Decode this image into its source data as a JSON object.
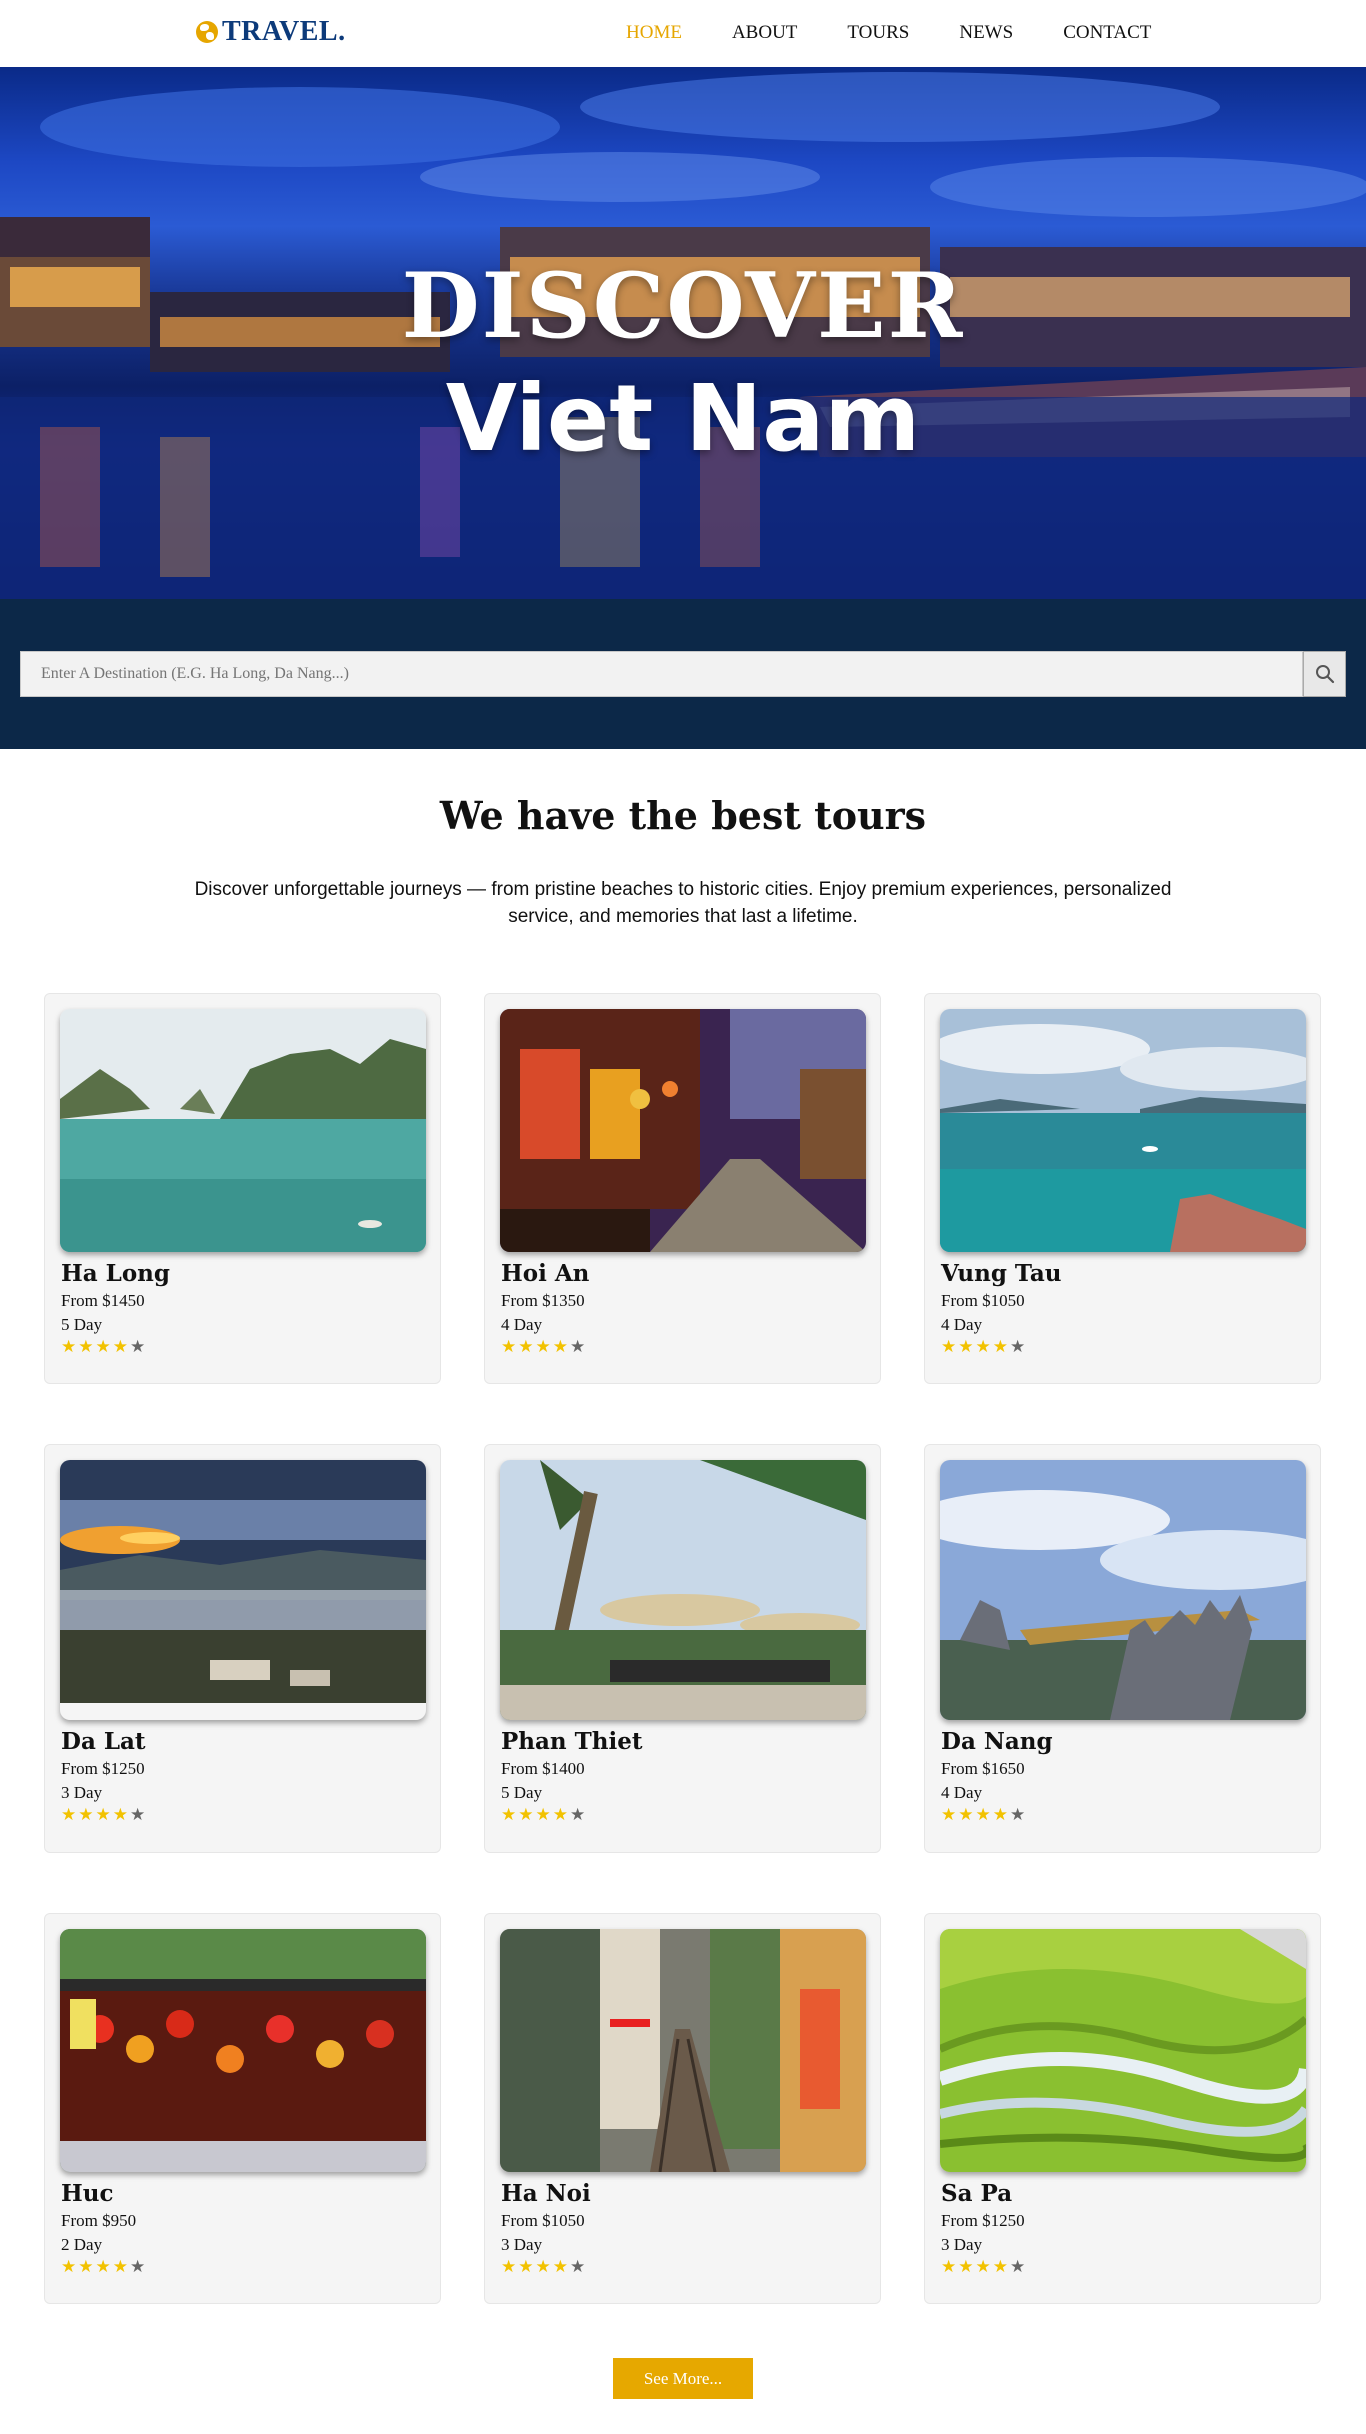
{
  "header": {
    "logo_text": "TRAVEL.",
    "nav": [
      {
        "label": "HOME",
        "active": true
      },
      {
        "label": "ABOUT",
        "active": false
      },
      {
        "label": "TOURS",
        "active": false
      },
      {
        "label": "NEWS",
        "active": false
      },
      {
        "label": "CONTACT",
        "active": false
      }
    ]
  },
  "hero": {
    "title_line1": "DISCOVER",
    "title_line2": "Viet Nam"
  },
  "search": {
    "placeholder": "Enter A Destination (E.G. Ha Long, Da Nang...)",
    "button_icon": "search-icon"
  },
  "intro": {
    "title": "We have the best tours",
    "description": "Discover unforgettable journeys — from pristine beaches to historic cities. Enjoy premium experiences, personalized service, and memories that last a lifetime."
  },
  "tours": [
    {
      "name": "Ha Long",
      "price": "From $1450",
      "days": "5 Day",
      "rating": 4
    },
    {
      "name": "Hoi An",
      "price": "From $1350",
      "days": "4 Day",
      "rating": 4
    },
    {
      "name": "Vung Tau",
      "price": "From $1050",
      "days": "4 Day",
      "rating": 4
    },
    {
      "name": "Da Lat",
      "price": "From $1250",
      "days": "3 Day",
      "rating": 4
    },
    {
      "name": "Phan Thiet",
      "price": "From $1400",
      "days": "5 Day",
      "rating": 4
    },
    {
      "name": "Da Nang",
      "price": "From $1650",
      "days": "4 Day",
      "rating": 4
    },
    {
      "name": "Huc",
      "price": "From $950",
      "days": "2 Day",
      "rating": 4
    },
    {
      "name": "Ha Noi",
      "price": "From $1050",
      "days": "3 Day",
      "rating": 4
    },
    {
      "name": "Sa Pa",
      "price": "From $1250",
      "days": "3 Day",
      "rating": 4
    }
  ],
  "see_more_label": "See More...",
  "colors": {
    "accent": "#e6a600",
    "logo": "#0c3a7a",
    "search_band": "#0c2848",
    "star_filled": "#f2c200",
    "star_empty": "#666666"
  }
}
